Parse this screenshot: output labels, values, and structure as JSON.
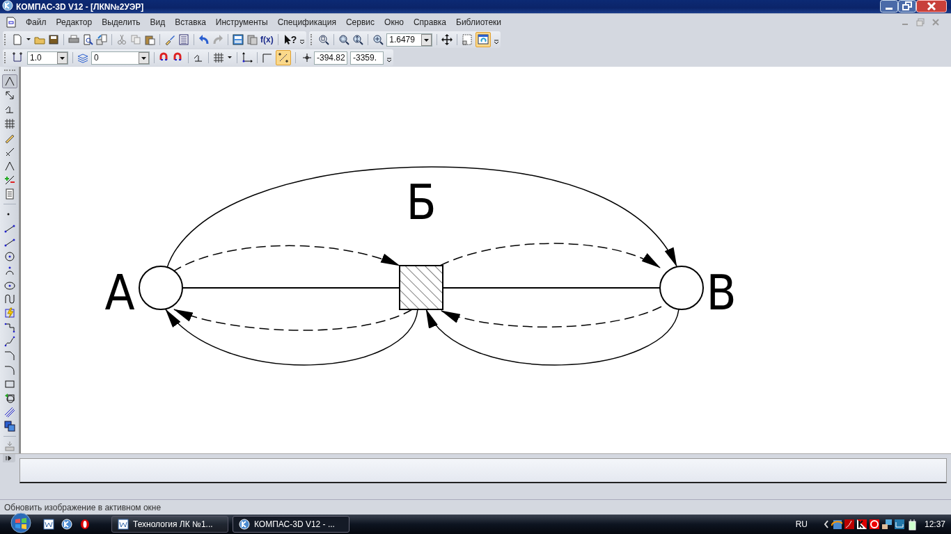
{
  "window": {
    "title": "КОМПАС-3D V12 - [ЛКN№2УЭР]"
  },
  "menu": [
    "Файл",
    "Редактор",
    "Выделить",
    "Вид",
    "Вставка",
    "Инструменты",
    "Спецификация",
    "Сервис",
    "Окно",
    "Справка",
    "Библиотеки"
  ],
  "toolbar_1": {
    "fx_label": "f(x)",
    "help_mark": "?",
    "zoom_value": "1.6479",
    "refresh_toggle": {
      "on": true
    }
  },
  "toolbar_2": {
    "step_value": "1.0",
    "layer_value": "0",
    "snap_toggle": {
      "on": true
    },
    "x_value": "-394.82",
    "y_value": "-3359."
  },
  "left_toolbar": {
    "first_tool": {
      "on": true
    }
  },
  "diagram": {
    "nodes": [
      {
        "kind": "circle",
        "label": "А"
      },
      {
        "kind": "square"
      },
      {
        "kind": "circle",
        "label": "В"
      }
    ],
    "arc_label": "Б"
  },
  "status_bar": {
    "message": "Обновить изображение в активном окне"
  },
  "taskbar": {
    "tasks": [
      {
        "label": "Технология ЛК №1...",
        "selected": false
      },
      {
        "label": "КОМПАС-3D V12 - ...",
        "selected": true
      }
    ],
    "language": "RU",
    "clock": "12:37"
  }
}
